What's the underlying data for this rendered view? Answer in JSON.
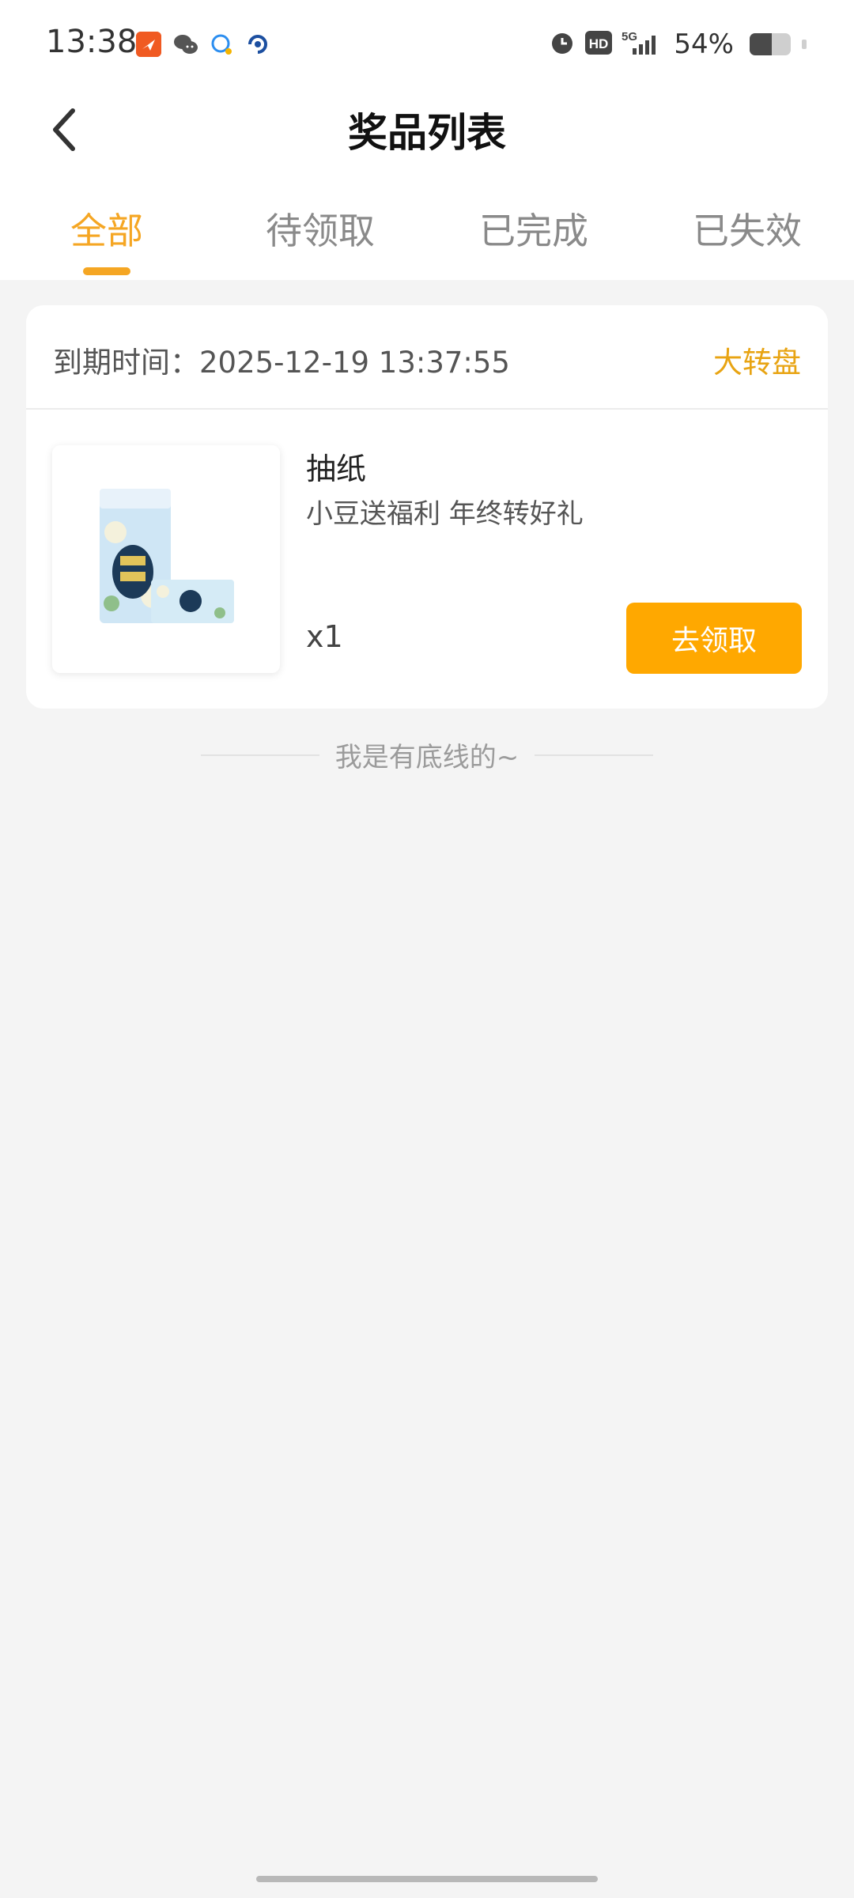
{
  "status_bar": {
    "time": "13:38",
    "battery_percent_text": "54%",
    "battery_level": 0.54,
    "notification_icons": [
      "app-notification-icon",
      "wechat-icon",
      "message-icon",
      "browser-icon"
    ],
    "right_icons": [
      "alarm-icon",
      "hd-icon",
      "5g-signal-icon",
      "battery-icon"
    ],
    "hd_label": "HD",
    "network_label": "5G"
  },
  "header": {
    "title": "奖品列表",
    "back_icon": "chevron-left-icon"
  },
  "tabs": [
    {
      "label": "全部",
      "active": true
    },
    {
      "label": "待领取",
      "active": false
    },
    {
      "label": "已完成",
      "active": false
    },
    {
      "label": "已失效",
      "active": false
    }
  ],
  "prize_card": {
    "expiry_text": "到期时间：2025-12-19 13:37:55",
    "source_text": "大转盘",
    "product_name": "抽纸",
    "product_desc": "小豆送福利 年终转好礼",
    "quantity": "x1",
    "claim_button": "去领取"
  },
  "footer": {
    "bottom_text": "我是有底线的~"
  },
  "colors": {
    "accent": "#f5a623",
    "button": "#ffa800",
    "background": "#f4f4f4"
  }
}
